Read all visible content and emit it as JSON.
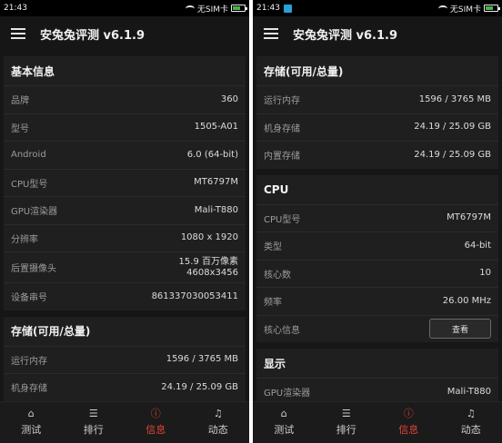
{
  "status": {
    "left_time": "21:43",
    "right_time": "21:43",
    "carrier": "无SIM卡"
  },
  "app": {
    "title": "安兔兔评测 v6.1.9"
  },
  "left": {
    "basic": {
      "title": "基本信息",
      "rows": [
        {
          "label": "品牌",
          "value": "360"
        },
        {
          "label": "型号",
          "value": "1505-A01"
        },
        {
          "label": "Android",
          "value": "6.0 (64-bit)"
        },
        {
          "label": "CPU型号",
          "value": "MT6797M"
        },
        {
          "label": "GPU渲染器",
          "value": "Mali-T880"
        },
        {
          "label": "分辨率",
          "value": "1080 x 1920"
        },
        {
          "label": "后置摄像头",
          "value": "15.9 百万像素",
          "value2": "4608x3456"
        },
        {
          "label": "设备串号",
          "value": "861337030053411"
        }
      ]
    },
    "storage": {
      "title": "存储(可用/总量)",
      "rows": [
        {
          "label": "运行内存",
          "value": "1596 / 3765 MB"
        },
        {
          "label": "机身存储",
          "value": "24.19 / 25.09 GB"
        }
      ]
    }
  },
  "right": {
    "storage": {
      "title": "存储(可用/总量)",
      "rows": [
        {
          "label": "运行内存",
          "value": "1596 / 3765 MB"
        },
        {
          "label": "机身存储",
          "value": "24.19 / 25.09 GB"
        },
        {
          "label": "内置存储",
          "value": "24.19 / 25.09 GB"
        }
      ]
    },
    "cpu": {
      "title": "CPU",
      "rows": [
        {
          "label": "CPU型号",
          "value": "MT6797M"
        },
        {
          "label": "类型",
          "value": "64-bit"
        },
        {
          "label": "核心数",
          "value": "10"
        },
        {
          "label": "频率",
          "value": "26.00 MHz"
        }
      ],
      "core_info_label": "核心信息",
      "view_button": "查看"
    },
    "display": {
      "title": "显示",
      "rows": [
        {
          "label": "GPU渲染器",
          "value": "Mali-T880"
        }
      ]
    }
  },
  "nav": {
    "items": [
      {
        "label": "测试",
        "icon": "home-icon",
        "glyph": "⌂"
      },
      {
        "label": "排行",
        "icon": "list-icon",
        "glyph": "☰"
      },
      {
        "label": "信息",
        "icon": "info-icon",
        "glyph": "ⓘ"
      },
      {
        "label": "动态",
        "icon": "bell-icon",
        "glyph": "♫"
      }
    ],
    "active_index": 2,
    "active_color": "#e0443a"
  }
}
